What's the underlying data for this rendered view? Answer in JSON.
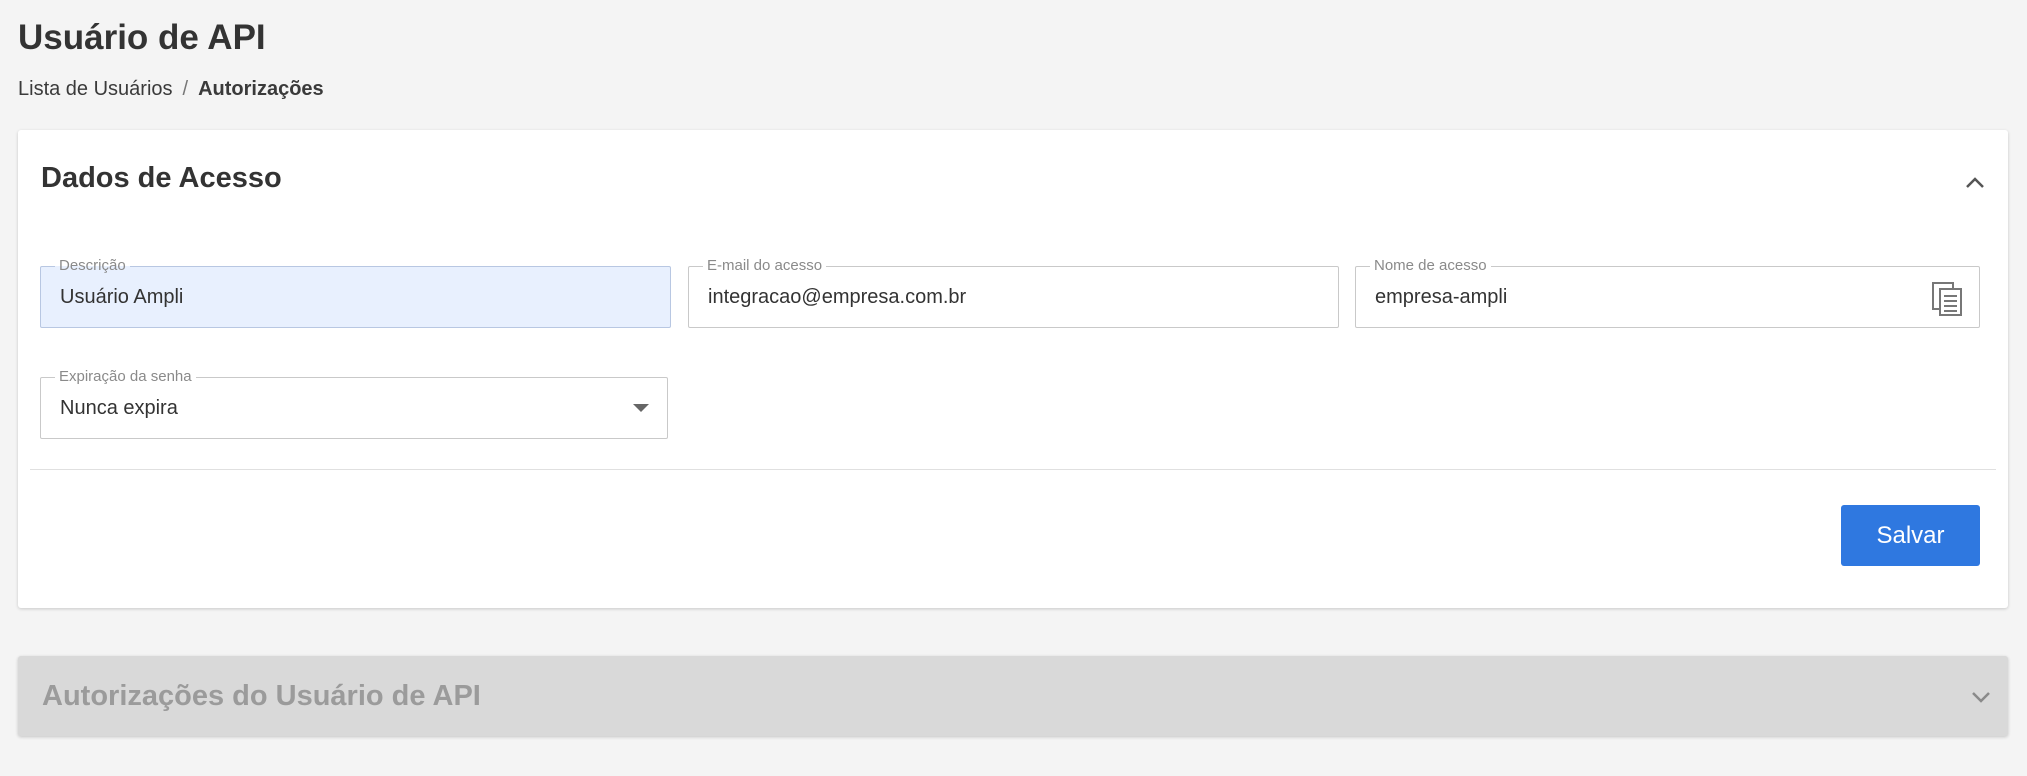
{
  "header": {
    "title": "Usuário de API",
    "breadcrumb": {
      "parent": "Lista de Usuários",
      "separator": "/",
      "current": "Autorizações"
    }
  },
  "access_card": {
    "title": "Dados de Acesso",
    "fields": {
      "descricao": {
        "label": "Descrição",
        "value": "Usuário Ampli"
      },
      "email": {
        "label": "E-mail do acesso",
        "value": "integracao@empresa.com.br"
      },
      "nome_acesso": {
        "label": "Nome de acesso",
        "value": "empresa-ampli"
      },
      "expiracao": {
        "label": "Expiração da senha",
        "value": "Nunca expira"
      }
    },
    "save_label": "Salvar"
  },
  "auth_card": {
    "title": "Autorizações do Usuário de API"
  },
  "colors": {
    "accent": "#2f78e0",
    "highlight_field": "#e8f0fe",
    "page_bg": "#f4f4f4"
  },
  "icons": {
    "collapse": "chevron-up-icon",
    "expand": "chevron-down-icon",
    "copy": "copy-icon",
    "dropdown": "caret-down-icon"
  }
}
